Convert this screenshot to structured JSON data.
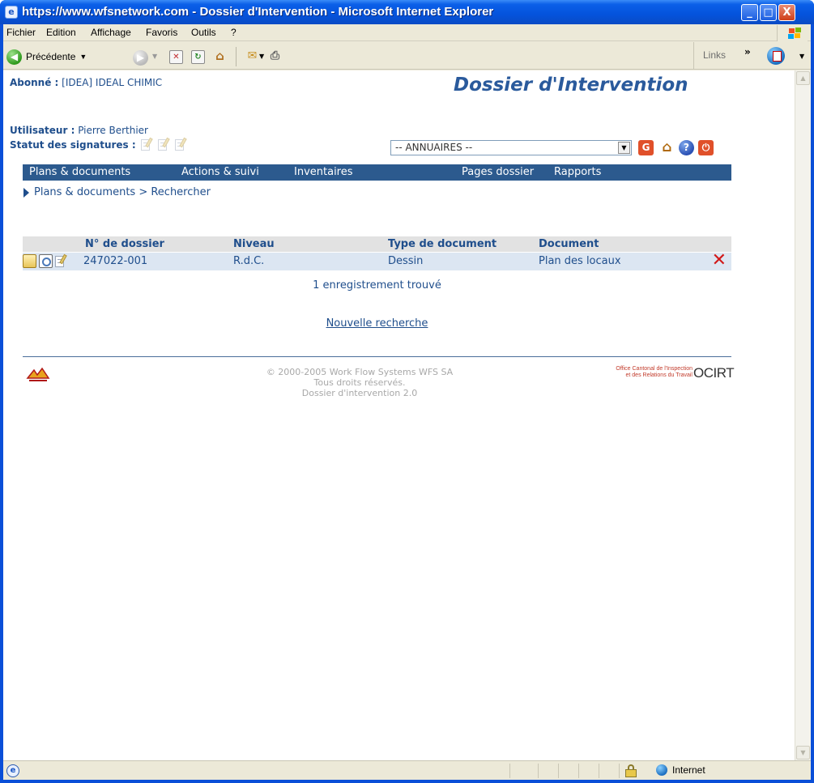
{
  "window": {
    "title": "https://www.wfsnetwork.com - Dossier d'Intervention - Microsoft Internet Explorer",
    "minimize": "_",
    "maximize": "□",
    "close": "X"
  },
  "menubar": {
    "items": [
      "Fichier",
      "Edition",
      "Affichage",
      "Favoris",
      "Outils",
      "?"
    ]
  },
  "toolbar": {
    "back_label": "Précédente",
    "links_label": "Links",
    "chevron": "»"
  },
  "page": {
    "subscriber_label": "Abonné :",
    "subscriber_value": "[IDEA] IDEAL CHIMIC",
    "title": "Dossier d'Intervention",
    "user_label": "Utilisateur :",
    "user_value": "Pierre Berthier",
    "signatures_label": "Statut des signatures :",
    "directory_select": "-- ANNUAIRES --",
    "nav": [
      "Plans & documents",
      "Actions & suivi",
      "Inventaires",
      "Pages dossier",
      "Rapports"
    ],
    "breadcrumb": "Plans & documents > Rechercher",
    "table": {
      "headers": [
        "N° de dossier",
        "Niveau",
        "Type de document",
        "Document"
      ],
      "rows": [
        {
          "dossier": "247022-001",
          "niveau": "R.d.C.",
          "type": "Dessin",
          "document": "Plan des locaux"
        }
      ]
    },
    "result_count": "1 enregistrement trouvé",
    "new_search": "Nouvelle recherche",
    "footer": {
      "copyright": "© 2000-2005 Work Flow Systems WFS SA",
      "rights": "Tous droits réservés.",
      "version": "Dossier d'intervention 2.0",
      "ocirt_small_1": "Office Cantonal de l'Inspection",
      "ocirt_small_2": "et des Relations du Travail",
      "ocirt": "OCIRT"
    }
  },
  "statusbar": {
    "zone": "Internet"
  },
  "colors": {
    "nav_bar": "#2c5a8e",
    "link_text": "#1f4e8c",
    "row_bg": "#dce6f2",
    "delete": "#d11a1a"
  }
}
